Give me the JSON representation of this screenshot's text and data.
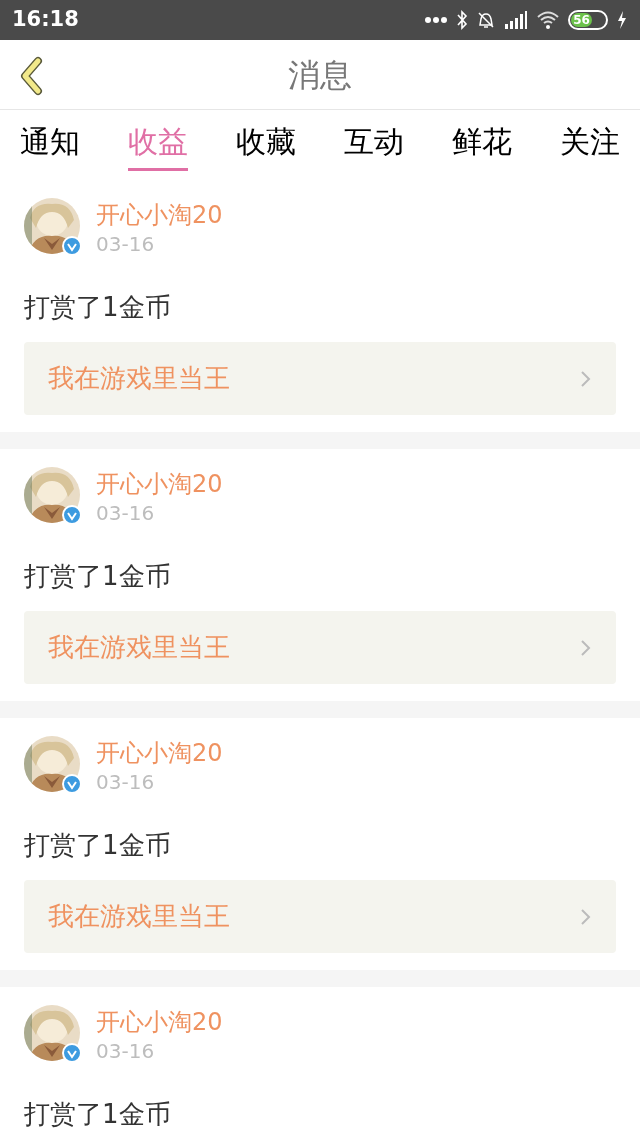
{
  "status_bar": {
    "time": "16:18",
    "battery": "56",
    "charging": true
  },
  "header": {
    "title": "消息"
  },
  "tabs": [
    {
      "label": "通知",
      "selected": false
    },
    {
      "label": "收益",
      "selected": true
    },
    {
      "label": "收藏",
      "selected": false
    },
    {
      "label": "互动",
      "selected": false
    },
    {
      "label": "鲜花",
      "selected": false
    },
    {
      "label": "关注",
      "selected": false
    }
  ],
  "messages": [
    {
      "user": "开心小淘20",
      "verified": true,
      "date": "03-16",
      "text": "打赏了1金币",
      "link": "我在游戏里当王"
    },
    {
      "user": "开心小淘20",
      "verified": true,
      "date": "03-16",
      "text": "打赏了1金币",
      "link": "我在游戏里当王"
    },
    {
      "user": "开心小淘20",
      "verified": true,
      "date": "03-16",
      "text": "打赏了1金币",
      "link": "我在游戏里当王"
    },
    {
      "user": "开心小淘20",
      "verified": true,
      "date": "03-16",
      "text": "打赏了1金币"
    }
  ]
}
